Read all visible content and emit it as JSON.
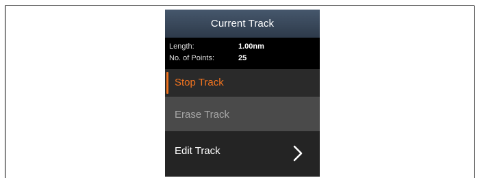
{
  "device": {
    "title": "Current Track",
    "info": {
      "length_label": "Length:",
      "length_value": "1.00nm",
      "points_label": "No. of Points:",
      "points_value": "25"
    },
    "menu": [
      {
        "label": "Stop Track",
        "state": "selected"
      },
      {
        "label": "Erase Track",
        "state": "disabled"
      },
      {
        "label": "Edit Track",
        "state": "normal",
        "icon": "chevron-right-icon"
      }
    ]
  },
  "colors": {
    "accent": "#f0731f",
    "title_bar": "#3a4a5e",
    "background": "#1f1f1f"
  }
}
